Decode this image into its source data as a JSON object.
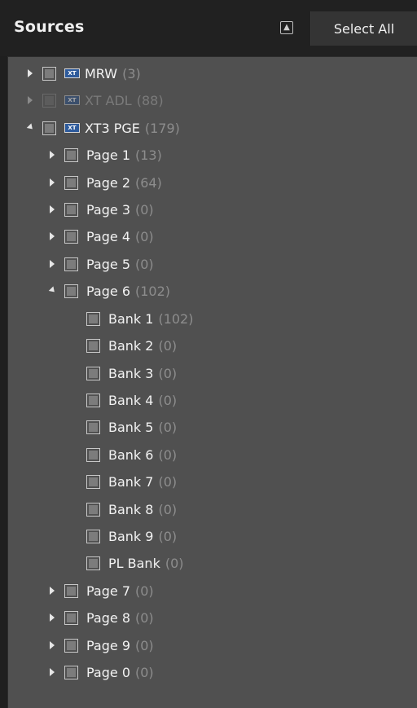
{
  "header": {
    "title": "Sources",
    "select_all_label": "Select All"
  },
  "icons": {
    "xt_badge_text": "XT"
  },
  "sources": [
    {
      "label": "MRW",
      "count": "(3)",
      "state": "collapsed",
      "enabled": true
    },
    {
      "label": "XT ADL",
      "count": "(88)",
      "state": "collapsed",
      "enabled": false
    },
    {
      "label": "XT3 PGE",
      "count": "(179)",
      "state": "expanded",
      "enabled": true
    }
  ],
  "pages": [
    {
      "label": "Page 1",
      "count": "(13)"
    },
    {
      "label": "Page 2",
      "count": "(64)"
    },
    {
      "label": "Page 3",
      "count": "(0)"
    },
    {
      "label": "Page 4",
      "count": "(0)"
    },
    {
      "label": "Page 5",
      "count": "(0)"
    },
    {
      "label": "Page 6",
      "count": "(102)"
    },
    {
      "label": "Page 7",
      "count": "(0)"
    },
    {
      "label": "Page 8",
      "count": "(0)"
    },
    {
      "label": "Page 9",
      "count": "(0)"
    },
    {
      "label": "Page 0",
      "count": "(0)"
    }
  ],
  "banks": [
    {
      "label": "Bank 1",
      "count": "(102)"
    },
    {
      "label": "Bank 2",
      "count": "(0)"
    },
    {
      "label": "Bank 3",
      "count": "(0)"
    },
    {
      "label": "Bank 4",
      "count": "(0)"
    },
    {
      "label": "Bank 5",
      "count": "(0)"
    },
    {
      "label": "Bank 6",
      "count": "(0)"
    },
    {
      "label": "Bank 7",
      "count": "(0)"
    },
    {
      "label": "Bank 8",
      "count": "(0)"
    },
    {
      "label": "Bank 9",
      "count": "(0)"
    },
    {
      "label": "PL Bank",
      "count": "(0)"
    }
  ]
}
